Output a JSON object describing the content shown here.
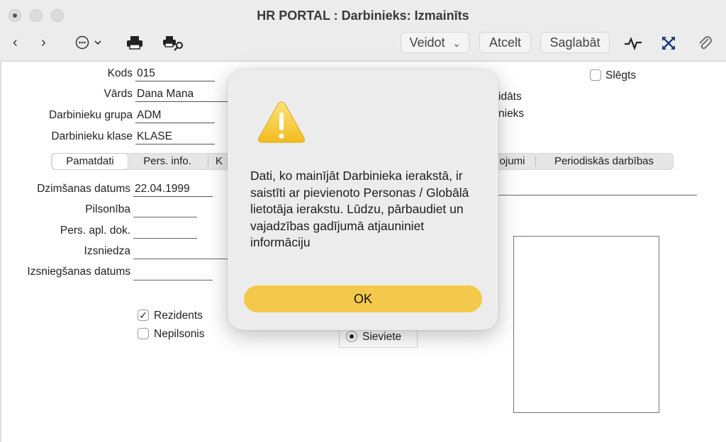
{
  "window": {
    "title": "HR PORTAL : Darbinieks: Izmainīts"
  },
  "toolbar": {
    "create_label": "Veidot",
    "cancel_label": "Atcelt",
    "save_label": "Saglabāt",
    "more_icon": "ellipsis-circle-icon",
    "print_icon": "printer-icon",
    "print_preview_icon": "print-preview-icon"
  },
  "form": {
    "code_label": "Kods",
    "code_value": "015",
    "name_label": "Vārds",
    "name_value": "Dana Mana",
    "group_label": "Darbinieku grupa",
    "group_value": "ADM",
    "class_label": "Darbinieku klase",
    "class_value": "KLASE",
    "closed_label": "Slēgts",
    "candidate_partial": "idāts",
    "employee_partial": "nieks"
  },
  "tabs": {
    "basic": "Pamatdati",
    "personal": "Pers. info.",
    "partial_k": "K",
    "partial_s": "ojumi",
    "periodic": "Periodiskās darbības"
  },
  "details": {
    "birth_label": "Dzimšanas datums",
    "birth_value": "22.04.1999",
    "citizenship_label": "Pilsonība",
    "id_doc_label": "Pers. apl. dok.",
    "issued_by_label": "Izsniedza",
    "issue_date_label": "Izsniegšanas datums",
    "resident_label": "Rezidents",
    "resident_checked": true,
    "noncitizen_label": "Nepilsonis",
    "noncitizen_checked": false,
    "female_label": "Sieviete",
    "female_selected": true
  },
  "alert": {
    "icon": "warning-icon",
    "message": "Dati, ko mainījāt Darbinieka ierakstā, ir saistīti ar pievienoto Personas / Globālā lietotāja ierakstu. Lūdzu, pārbaudiet un vajadzības gadījumā atjauniniet informāciju",
    "ok_label": "OK",
    "accent": "#f4c84a"
  }
}
